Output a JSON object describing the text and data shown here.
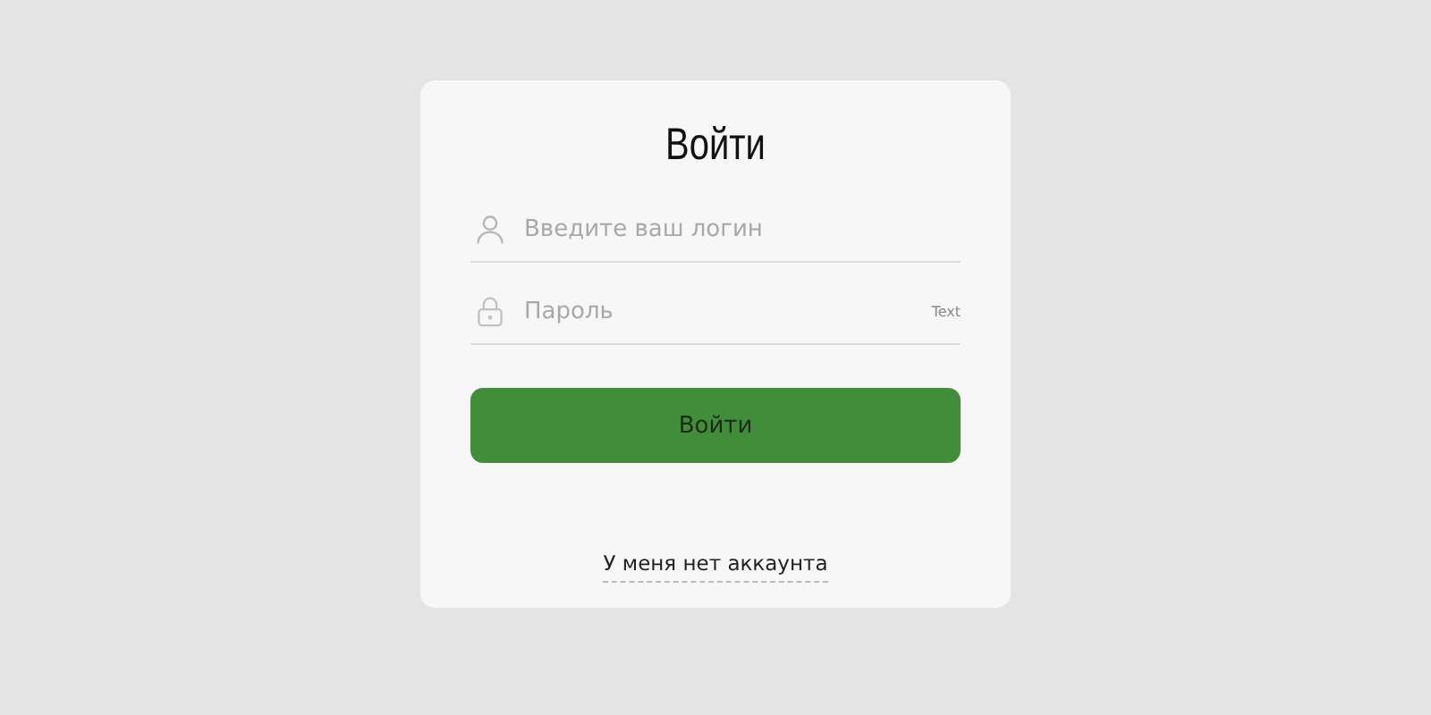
{
  "title": "Войти",
  "fields": [
    {
      "kind": "login",
      "placeholder": "Введите ваш логин"
    },
    {
      "kind": "password",
      "placeholder": "Пароль",
      "toggle": "Text"
    }
  ],
  "submit_button": "Войти",
  "register_link": "У меня нет аккаунта"
}
